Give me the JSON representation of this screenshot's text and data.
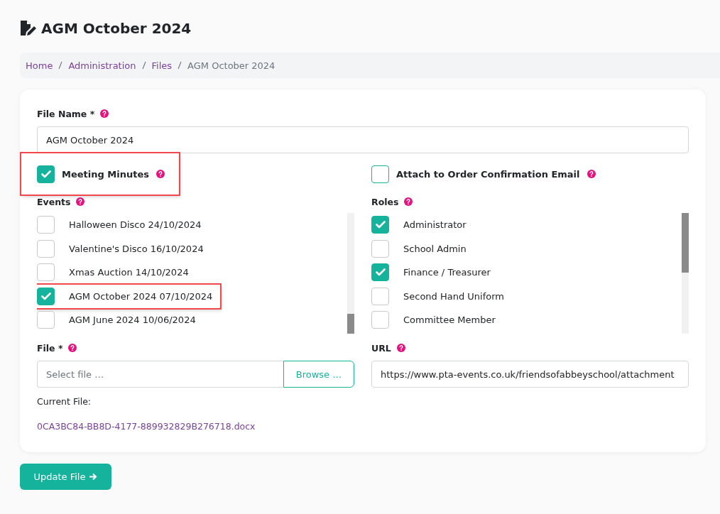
{
  "page_title": "AGM October 2024",
  "breadcrumb": [
    {
      "label": "Home",
      "kind": "link"
    },
    {
      "label": "Administration",
      "kind": "link"
    },
    {
      "label": "Files",
      "kind": "link"
    },
    {
      "label": "AGM October 2024",
      "kind": "current"
    }
  ],
  "file_name": {
    "label": "File Name *",
    "value": "AGM October 2024"
  },
  "meeting_minutes": {
    "label": "Meeting Minutes",
    "checked": true,
    "highlighted": true
  },
  "attach_to_email": {
    "label": "Attach to Order Confirmation Email",
    "checked": false,
    "highlighted": false
  },
  "events": {
    "label": "Events",
    "items": [
      {
        "label": "Halloween Disco 24/10/2024",
        "checked": false,
        "highlighted": false
      },
      {
        "label": "Valentine's Disco 16/10/2024",
        "checked": false,
        "highlighted": false
      },
      {
        "label": "Xmas Auction 14/10/2024",
        "checked": false,
        "highlighted": false
      },
      {
        "label": "AGM October 2024 07/10/2024",
        "checked": true,
        "highlighted": true
      },
      {
        "label": "AGM June 2024 10/06/2024",
        "checked": false,
        "highlighted": false
      }
    ]
  },
  "roles": {
    "label": "Roles",
    "items": [
      {
        "label": "Administrator",
        "checked": true,
        "highlighted": false
      },
      {
        "label": "School Admin",
        "checked": false,
        "highlighted": false
      },
      {
        "label": "Finance / Treasurer",
        "checked": true,
        "highlighted": false
      },
      {
        "label": "Second Hand Uniform",
        "checked": false,
        "highlighted": false
      },
      {
        "label": "Committee Member",
        "checked": false,
        "highlighted": false
      }
    ]
  },
  "file": {
    "label": "File *",
    "placeholder": "Select file …",
    "button": "Browse …"
  },
  "url": {
    "label": "URL",
    "value": "https://www.pta-events.co.uk/friendsofabbeyschool/attachment"
  },
  "current_file": {
    "label": "Current File:",
    "link": "0CA3BC84-BB8D-4177-889932829B276718.docx"
  },
  "submit_button": "Update File"
}
